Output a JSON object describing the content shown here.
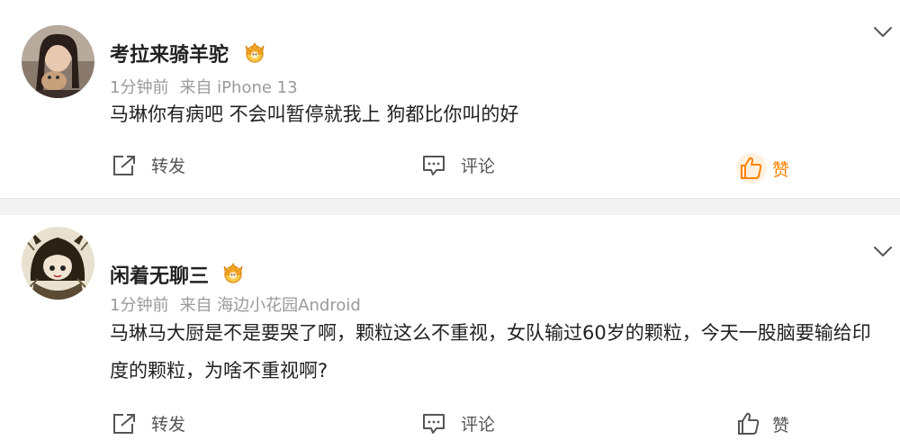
{
  "posts": [
    {
      "username": "考拉来骑羊驼",
      "time": "1分钟前",
      "source": "来自 iPhone 13",
      "content": "马琳你有病吧 不会叫暂停就我上 狗都比你叫的好",
      "actions": {
        "repost": "转发",
        "comment": "评论",
        "like": "赞"
      },
      "liked": true
    },
    {
      "username": "闲着无聊三",
      "time": "1分钟前",
      "source": "来自 海边小花园Android",
      "content": "马琳马大厨是不是要哭了啊，颗粒这么不重视，女队输过60岁的颗粒，今天一股脑要输给印度的颗粒，为啥不重视啊?",
      "actions": {
        "repost": "转发",
        "comment": "评论",
        "like": "赞"
      },
      "liked": false
    }
  ],
  "colors": {
    "like_active": "#ff8200",
    "meta_text": "#9a9a9a",
    "divider": "#f2f2f2",
    "icon": "#555555",
    "badge_gold": "#f5a623"
  },
  "icons": {
    "repost": "repost-icon",
    "comment": "comment-icon",
    "like": "thumbs-up-icon",
    "menu": "chevron-down-icon",
    "badge": "crown-badge-icon"
  }
}
